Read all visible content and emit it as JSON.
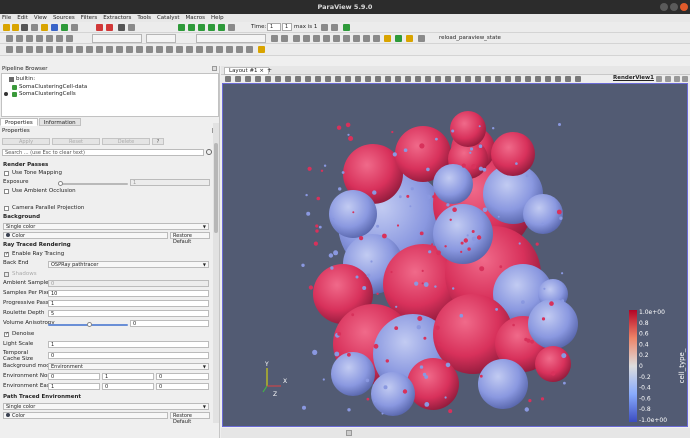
{
  "window": {
    "title": "ParaView 5.9.0"
  },
  "menu": [
    "File",
    "Edit",
    "View",
    "Sources",
    "Filters",
    "Extractors",
    "Tools",
    "Catalyst",
    "Macros",
    "Help"
  ],
  "time_toolbar": {
    "time_label": "Time:",
    "time_value": "1",
    "step_value": "1",
    "max_label": "max is 1"
  },
  "macro_toolbar": {
    "macro_label": "reload_paraview_state"
  },
  "pipeline": {
    "header": "Pipeline Browser",
    "items": [
      "builtin:",
      "SomaClusteringCell-data",
      "SomaClusteringCells"
    ]
  },
  "tabs": [
    "Properties",
    "Information"
  ],
  "properties": {
    "header": "Properties",
    "apply": "Apply",
    "reset": "Reset",
    "delete": "Delete",
    "help": "?",
    "search_placeholder": "Search ... (use Esc to clear text)",
    "sections": {
      "render_passes": "Render Passes",
      "background": "Background",
      "ray_traced": "Ray Traced Rendering",
      "path_traced": "Path Traced Environment"
    },
    "use_tone_mapping": "Use Tone Mapping",
    "exposure": "Exposure",
    "exposure_value": "1",
    "use_ambient_occlusion": "Use Ambient Occlusion",
    "camera_parallel": "Camera Parallel Projection",
    "bg_mode_value": "Single color",
    "color_label": "Color",
    "restore_default": "Restore Default",
    "enable_ray_tracing": "Enable Ray Tracing",
    "shadows": "Shadows",
    "back_end": "Back End",
    "back_end_value": "OSPRay pathtracer",
    "ambient_samples": "Ambient Samples",
    "ambient_samples_value": "0",
    "samples_per_pixel": "Samples Per Pixel",
    "samples_per_pixel_value": "10",
    "progressive_passes": "Progressive Passes",
    "progressive_passes_value": "1",
    "roulette_depth": "Roulette Depth",
    "roulette_depth_value": "5",
    "volume_anisotropy": "Volume Anisotropy",
    "volume_anisotropy_value": "0",
    "volume_anisotropy_level": 0.5,
    "denoise": "Denoise",
    "light_scale": "Light Scale",
    "light_scale_value": "1",
    "temporal_cache": "Temporal Cache Size",
    "temporal_cache_value": "0",
    "background_mode": "Background mode",
    "background_mode_value": "Environment",
    "env_north": "Environment North",
    "env_north_values": [
      "0",
      "1",
      "0"
    ],
    "env_east": "Environment East",
    "env_east_values": [
      "1",
      "0",
      "0"
    ],
    "path_bg_value": "Single color",
    "color2_label": "Color",
    "restore_default2": "Restore Default"
  },
  "layout": {
    "tab_label": "Layout #1",
    "close": "×",
    "add": "+",
    "render_view_label": "RenderView1"
  },
  "colorbar": {
    "title": "cell_type_",
    "ticks": [
      "1.0e+00",
      "0.8",
      "0.6",
      "0.4",
      "0.2",
      "0",
      "-0.2",
      "-0.4",
      "-0.6",
      "-0.8",
      "-1.0e+00"
    ],
    "high_color": "#c8103a",
    "low_color": "#4a5bd0"
  },
  "axes": {
    "x": "X",
    "y": "Y",
    "z": "Z"
  },
  "colors": {
    "red_cells": "#d8315b",
    "blue_cells": "#8a98e0",
    "view_bg": "#525b73"
  }
}
